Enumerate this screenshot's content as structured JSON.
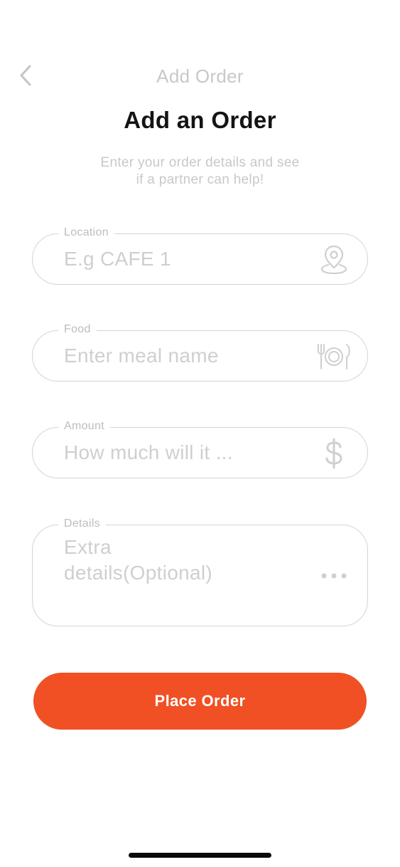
{
  "nav": {
    "title": "Add Order"
  },
  "page": {
    "heading": "Add an Order",
    "subtitle_line1": "Enter your order details and see",
    "subtitle_line2": "if a partner can help!"
  },
  "form": {
    "location": {
      "label": "Location",
      "placeholder": "E.g CAFE 1",
      "icon": "location-pin-icon"
    },
    "food": {
      "label": "Food",
      "placeholder": "Enter meal name",
      "icon": "fork-plate-knife-icon"
    },
    "amount": {
      "label": "Amount",
      "placeholder": "How much will it ...",
      "icon": "dollar-icon"
    },
    "details": {
      "label": "Details",
      "placeholder": "Extra details(Optional)",
      "icon": "more-dots-icon"
    }
  },
  "actions": {
    "place_order_label": "Place Order"
  },
  "colors": {
    "accent": "#f05024",
    "heading": "#141414",
    "muted": "#c8c8c8",
    "border": "#d4d4d4"
  }
}
